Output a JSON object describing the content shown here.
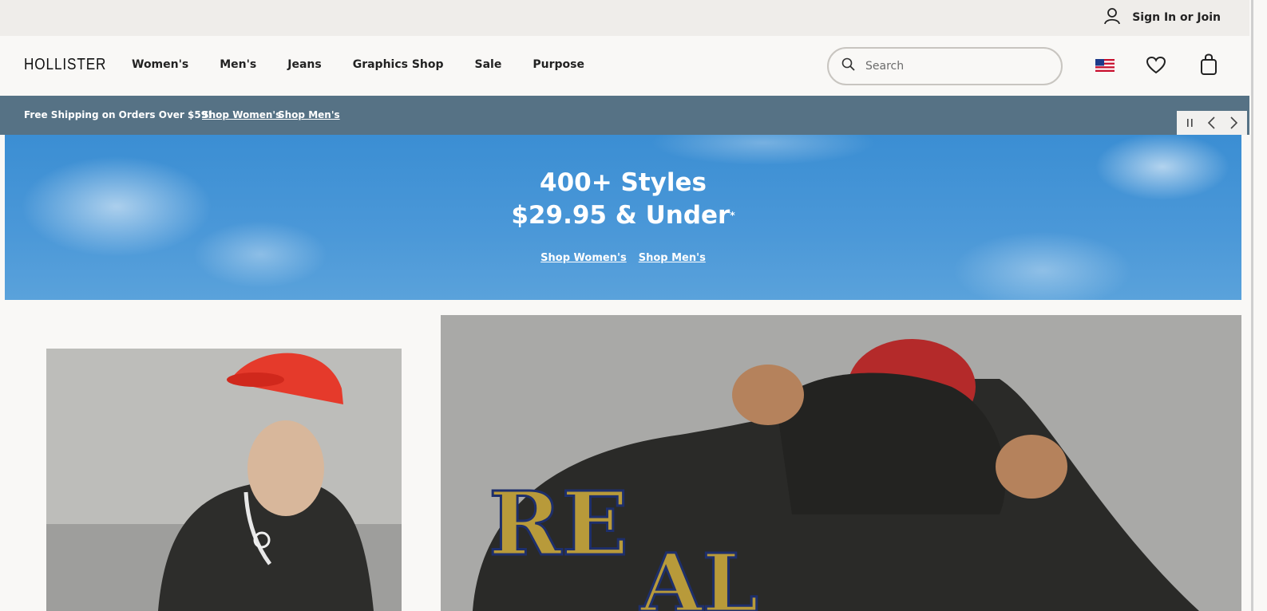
{
  "topbar": {
    "signin_label": "Sign In or Join"
  },
  "header": {
    "logo": "HOLLISTER",
    "nav": [
      {
        "label": "Women's"
      },
      {
        "label": "Men's"
      },
      {
        "label": "Jeans"
      },
      {
        "label": "Graphics Shop"
      },
      {
        "label": "Sale"
      },
      {
        "label": "Purpose"
      }
    ],
    "search_placeholder": "Search",
    "icons": [
      "search-icon",
      "us-flag-icon",
      "heart-icon",
      "shopping-bag-icon",
      "user-icon"
    ]
  },
  "promo": {
    "message": "Free Shipping on Orders Over $59!",
    "link_women": "Shop Women's",
    "link_men": "Shop Men's",
    "bg_color": "#567285"
  },
  "hero": {
    "line1": "400+ Styles",
    "line2": "$29.95 & Under",
    "asterisk": "*",
    "link_women": "Shop Women's",
    "link_men": "Shop Men's"
  },
  "colors": {
    "accent_blue": "#3b8ed3",
    "text_dark": "#222222",
    "bg": "#f9f8f6"
  }
}
